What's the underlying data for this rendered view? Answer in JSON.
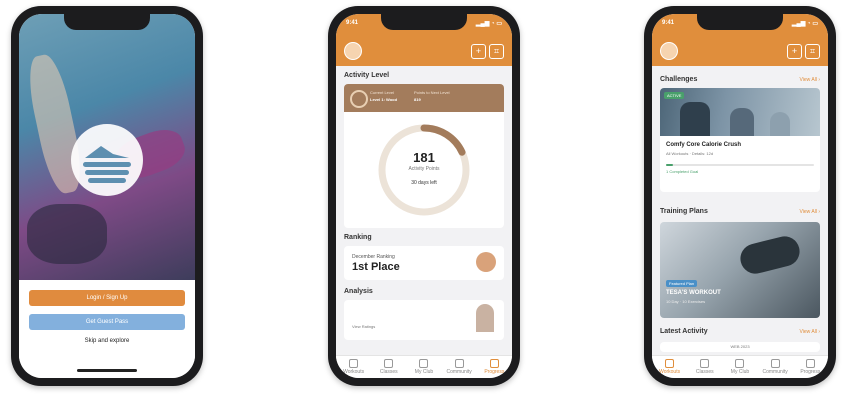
{
  "phone1": {
    "login_button": "Login / Sign Up",
    "guest_button": "Get Guest Pass",
    "skip_link": "Skip and explore"
  },
  "phone2": {
    "status_time": "9:41",
    "status_icons": "▂▄▆ ◔ ▭",
    "section_activity_level": "Activity Level",
    "activity_current_label": "Current Level",
    "activity_current_value": "Level 1: Wood",
    "activity_next_label": "Points to Next Level",
    "activity_next_value": "819",
    "activity_points": "181",
    "activity_points_label": "Activity Points",
    "activity_days": "30 days left",
    "activity_progress": 0.18,
    "section_ranking": "Ranking",
    "ranking_label": "December Ranking",
    "ranking_place": "1st Place",
    "section_analysis": "Analysis",
    "analysis_label": "View Ratings",
    "tabs": [
      {
        "label": "Workouts",
        "active": false
      },
      {
        "label": "Classes",
        "active": false
      },
      {
        "label": "My Club",
        "active": false
      },
      {
        "label": "Community",
        "active": false
      },
      {
        "label": "Progress",
        "active": true
      }
    ]
  },
  "phone3": {
    "status_time": "9:41",
    "status_icons": "▂▄▆ ◔ ▭",
    "section_challenges": "Challenges",
    "view_all_challenges": "View All ›",
    "challenge_tag": "ACTIVE",
    "challenge_title": "Comfy Core Calorie Crush",
    "challenge_sub": "All Workouts · Details: 12d",
    "challenge_progress_label": "1 Completed Goal",
    "challenge_progress": 0.05,
    "section_training": "Training Plans",
    "view_all_training": "View All ›",
    "training_tag": "Featured Plan",
    "training_title": "TESA'S WORKOUT",
    "training_sub": "10 Day · 10 Exercises",
    "section_latest": "Latest Activity",
    "view_all_latest": "View All ›",
    "latest_item": "WEB 2023",
    "tabs": [
      {
        "label": "Workouts",
        "active": true
      },
      {
        "label": "Classes",
        "active": false
      },
      {
        "label": "My Club",
        "active": false
      },
      {
        "label": "Community",
        "active": false
      },
      {
        "label": "Progress",
        "active": false
      }
    ]
  },
  "colors": {
    "brand_orange": "#e08e3c",
    "secondary_blue": "#83b0dd",
    "activity_brown": "#a37c5c",
    "success_green": "#49a06b"
  },
  "icons": {
    "header_add": "plus-icon",
    "header_qr": "scan-icon"
  }
}
